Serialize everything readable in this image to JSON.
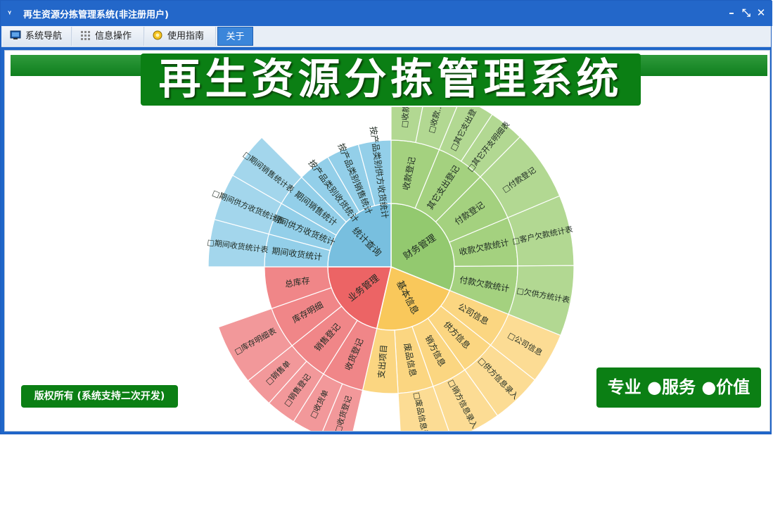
{
  "window": {
    "title": "再生资源分拣管理系统(非注册用户)",
    "controls": {
      "minimize": "–",
      "restore": "⤡",
      "close": "✕"
    }
  },
  "menubar": {
    "items": [
      {
        "label": "系统导航",
        "icon": "monitor-icon"
      },
      {
        "label": "信息操作",
        "icon": "grid-icon"
      },
      {
        "label": "使用指南",
        "icon": "help-bulb-icon"
      },
      {
        "label": "关于",
        "icon": ""
      }
    ],
    "active_index": 3
  },
  "banner": {
    "title": "再生资源分拣管理系统"
  },
  "footer": {
    "copyright": "版权所有 (系统支持二次开发)",
    "slogan": "专业 ●服务 ●价值"
  },
  "colors": {
    "titlebar": "#2367c9",
    "accent_green": "#0b7f14",
    "finance": "#93c96f",
    "basic": "#f9c85b",
    "business": "#ec6465",
    "stats": "#78bfdf"
  },
  "sunburst": {
    "categories": [
      {
        "name": "财务管理",
        "color": "#93c96f",
        "children": [
          {
            "name": "收款登记",
            "color": "#a4d17f",
            "leaves": [
              "□收款...",
              "□收款..."
            ]
          },
          {
            "name": "其它支出登记",
            "color": "#a4d17f",
            "leaves": [
              "□其它支出登",
              "□其它开支明细表"
            ]
          },
          {
            "name": "付款登记",
            "color": "#a4d17f",
            "leaves": [
              "□付款登记"
            ]
          },
          {
            "name": "收款欠款统计",
            "color": "#a4d17f",
            "leaves": [
              "□客户欠款统计表"
            ]
          },
          {
            "name": "付款欠款统计",
            "color": "#a4d17f",
            "leaves": [
              "□欠供方统计表"
            ]
          }
        ]
      },
      {
        "name": "基本信息",
        "color": "#f9c85b",
        "children": [
          {
            "name": "公司信息",
            "color": "#fbd681",
            "leaves": [
              "□公司信息"
            ]
          },
          {
            "name": "供方信息",
            "color": "#fbd681",
            "leaves": [
              "□供方信息录入"
            ]
          },
          {
            "name": "销方信息",
            "color": "#fbd681",
            "leaves": [
              "□销方信息录入"
            ]
          },
          {
            "name": "废品信息",
            "color": "#fbd681",
            "leaves": [
              "□废品信息录入"
            ]
          },
          {
            "name": "支出项目",
            "color": "#fbd681",
            "leaves": []
          }
        ]
      },
      {
        "name": "业务管理",
        "color": "#ec6465",
        "children": [
          {
            "name": "收货登记",
            "color": "#f08688",
            "leaves": [
              "□收货登记",
              "□收货单"
            ]
          },
          {
            "name": "销售登记",
            "color": "#f08688",
            "leaves": [
              "□销售登记",
              "□销售单"
            ]
          },
          {
            "name": "库存明细",
            "color": "#f08688",
            "leaves": [
              "□库存明细表"
            ]
          },
          {
            "name": "总库存",
            "color": "#f08688",
            "leaves": []
          }
        ]
      },
      {
        "name": "统计查询",
        "color": "#78bfdf",
        "children": [
          {
            "name": "期间收货统计",
            "color": "#93cfe9",
            "leaves": [
              "□期间收货统计表"
            ]
          },
          {
            "name": "期间供方收货统计",
            "color": "#93cfe9",
            "leaves": [
              "□期间供方收货统计表"
            ]
          },
          {
            "name": "期间销售统计",
            "color": "#93cfe9",
            "leaves": [
              "□期间销售统计表"
            ]
          },
          {
            "name": "按产品类别收货统计",
            "color": "#93cfe9",
            "leaves": []
          },
          {
            "name": "按产品类别销售统计",
            "color": "#93cfe9",
            "leaves": []
          },
          {
            "name": "按产品类别供方收货统计",
            "color": "#93cfe9",
            "leaves": []
          }
        ]
      }
    ]
  }
}
